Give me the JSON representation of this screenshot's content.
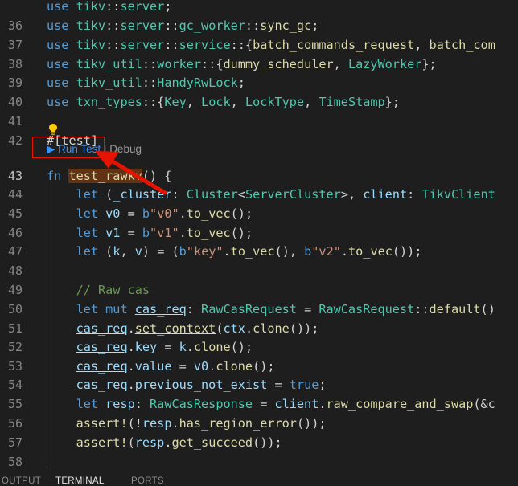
{
  "editor": {
    "lines": [
      {
        "n": "",
        "tokens": [
          [
            "kw",
            "use "
          ],
          [
            "ns",
            "tikv"
          ],
          [
            "p",
            "::"
          ],
          [
            "ns",
            "server"
          ],
          [
            "p",
            ";"
          ]
        ]
      },
      {
        "n": "36",
        "tokens": [
          [
            "kw",
            "use "
          ],
          [
            "ns",
            "tikv"
          ],
          [
            "p",
            "::"
          ],
          [
            "ns",
            "server"
          ],
          [
            "p",
            "::"
          ],
          [
            "ns",
            "gc_worker"
          ],
          [
            "p",
            "::"
          ],
          [
            "fn",
            "sync_gc"
          ],
          [
            "p",
            ";"
          ]
        ]
      },
      {
        "n": "37",
        "tokens": [
          [
            "kw",
            "use "
          ],
          [
            "ns",
            "tikv"
          ],
          [
            "p",
            "::"
          ],
          [
            "ns",
            "server"
          ],
          [
            "p",
            "::"
          ],
          [
            "ns",
            "service"
          ],
          [
            "p",
            "::{"
          ],
          [
            "fn",
            "batch_commands_request"
          ],
          [
            "p",
            ", "
          ],
          [
            "fn",
            "batch_com"
          ]
        ]
      },
      {
        "n": "38",
        "tokens": [
          [
            "kw",
            "use "
          ],
          [
            "ns",
            "tikv_util"
          ],
          [
            "p",
            "::"
          ],
          [
            "ns",
            "worker"
          ],
          [
            "p",
            "::{"
          ],
          [
            "fn",
            "dummy_scheduler"
          ],
          [
            "p",
            ", "
          ],
          [
            "ty",
            "LazyWorker"
          ],
          [
            "p",
            "};"
          ]
        ]
      },
      {
        "n": "39",
        "tokens": [
          [
            "kw",
            "use "
          ],
          [
            "ns",
            "tikv_util"
          ],
          [
            "p",
            "::"
          ],
          [
            "ty",
            "HandyRwLock"
          ],
          [
            "p",
            ";"
          ]
        ]
      },
      {
        "n": "40",
        "tokens": [
          [
            "kw",
            "use "
          ],
          [
            "ns",
            "txn_types"
          ],
          [
            "p",
            "::{"
          ],
          [
            "ty",
            "Key"
          ],
          [
            "p",
            ", "
          ],
          [
            "ty",
            "Lock"
          ],
          [
            "p",
            ", "
          ],
          [
            "ty",
            "LockType"
          ],
          [
            "p",
            ", "
          ],
          [
            "ty",
            "TimeStamp"
          ],
          [
            "p",
            "};"
          ]
        ]
      },
      {
        "n": "41",
        "tokens": []
      },
      {
        "n": "42",
        "tokens": [
          [
            "p",
            "#["
          ],
          [
            "p",
            "test"
          ],
          [
            "p",
            "]"
          ]
        ]
      },
      {
        "n": "43",
        "active": true,
        "tokens": [
          [
            "kw",
            "fn "
          ],
          [
            "fnhl",
            "test_rawkv"
          ],
          [
            "p",
            "() {"
          ]
        ]
      },
      {
        "n": "44",
        "tokens": [
          [
            "p",
            "    "
          ],
          [
            "kw",
            "let "
          ],
          [
            "p",
            "("
          ],
          [
            "var",
            "_cluster"
          ],
          [
            "p",
            ": "
          ],
          [
            "ty",
            "Cluster"
          ],
          [
            "p",
            "<"
          ],
          [
            "ty",
            "ServerCluster"
          ],
          [
            "p",
            ">, "
          ],
          [
            "var",
            "client"
          ],
          [
            "p",
            ": "
          ],
          [
            "ty",
            "TikvClient"
          ]
        ]
      },
      {
        "n": "45",
        "tokens": [
          [
            "p",
            "    "
          ],
          [
            "kw",
            "let "
          ],
          [
            "var",
            "v0"
          ],
          [
            "p",
            " = "
          ],
          [
            "kw",
            "b"
          ],
          [
            "str",
            "\"v0\""
          ],
          [
            "p",
            "."
          ],
          [
            "fn",
            "to_vec"
          ],
          [
            "p",
            "();"
          ]
        ]
      },
      {
        "n": "46",
        "tokens": [
          [
            "p",
            "    "
          ],
          [
            "kw",
            "let "
          ],
          [
            "var",
            "v1"
          ],
          [
            "p",
            " = "
          ],
          [
            "kw",
            "b"
          ],
          [
            "str",
            "\"v1\""
          ],
          [
            "p",
            "."
          ],
          [
            "fn",
            "to_vec"
          ],
          [
            "p",
            "();"
          ]
        ]
      },
      {
        "n": "47",
        "tokens": [
          [
            "p",
            "    "
          ],
          [
            "kw",
            "let "
          ],
          [
            "p",
            "("
          ],
          [
            "var",
            "k"
          ],
          [
            "p",
            ", "
          ],
          [
            "var",
            "v"
          ],
          [
            "p",
            ") = ("
          ],
          [
            "kw",
            "b"
          ],
          [
            "str",
            "\"key\""
          ],
          [
            "p",
            "."
          ],
          [
            "fn",
            "to_vec"
          ],
          [
            "p",
            "(), "
          ],
          [
            "kw",
            "b"
          ],
          [
            "str",
            "\"v2\""
          ],
          [
            "p",
            "."
          ],
          [
            "fn",
            "to_vec"
          ],
          [
            "p",
            "());"
          ]
        ]
      },
      {
        "n": "48",
        "tokens": []
      },
      {
        "n": "49",
        "tokens": [
          [
            "p",
            "    "
          ],
          [
            "cm",
            "// Raw cas"
          ]
        ]
      },
      {
        "n": "50",
        "tokens": [
          [
            "p",
            "    "
          ],
          [
            "kw",
            "let mut "
          ],
          [
            "varul",
            "cas_req"
          ],
          [
            "p",
            ": "
          ],
          [
            "ty",
            "RawCasRequest"
          ],
          [
            "p",
            " = "
          ],
          [
            "ty",
            "RawCasRequest"
          ],
          [
            "p",
            "::"
          ],
          [
            "fn",
            "default"
          ],
          [
            "p",
            "()"
          ]
        ]
      },
      {
        "n": "51",
        "tokens": [
          [
            "p",
            "    "
          ],
          [
            "varul",
            "cas_req"
          ],
          [
            "p",
            "."
          ],
          [
            "fnul",
            "set_context"
          ],
          [
            "p",
            "("
          ],
          [
            "var",
            "ctx"
          ],
          [
            "p",
            "."
          ],
          [
            "fn",
            "clone"
          ],
          [
            "p",
            "());"
          ]
        ]
      },
      {
        "n": "52",
        "tokens": [
          [
            "p",
            "    "
          ],
          [
            "varul",
            "cas_req"
          ],
          [
            "p",
            "."
          ],
          [
            "var",
            "key"
          ],
          [
            "p",
            " = "
          ],
          [
            "var",
            "k"
          ],
          [
            "p",
            "."
          ],
          [
            "fn",
            "clone"
          ],
          [
            "p",
            "();"
          ]
        ]
      },
      {
        "n": "53",
        "tokens": [
          [
            "p",
            "    "
          ],
          [
            "varul",
            "cas_req"
          ],
          [
            "p",
            "."
          ],
          [
            "var",
            "value"
          ],
          [
            "p",
            " = "
          ],
          [
            "var",
            "v0"
          ],
          [
            "p",
            "."
          ],
          [
            "fn",
            "clone"
          ],
          [
            "p",
            "();"
          ]
        ]
      },
      {
        "n": "54",
        "tokens": [
          [
            "p",
            "    "
          ],
          [
            "varul",
            "cas_req"
          ],
          [
            "p",
            "."
          ],
          [
            "var",
            "previous_not_exist"
          ],
          [
            "p",
            " = "
          ],
          [
            "kw",
            "true"
          ],
          [
            "p",
            ";"
          ]
        ]
      },
      {
        "n": "55",
        "tokens": [
          [
            "p",
            "    "
          ],
          [
            "kw",
            "let "
          ],
          [
            "var",
            "resp"
          ],
          [
            "p",
            ": "
          ],
          [
            "ty",
            "RawCasResponse"
          ],
          [
            "p",
            " = "
          ],
          [
            "var",
            "client"
          ],
          [
            "p",
            "."
          ],
          [
            "fn",
            "raw_compare_and_swap"
          ],
          [
            "p",
            "(&c"
          ]
        ]
      },
      {
        "n": "56",
        "tokens": [
          [
            "p",
            "    "
          ],
          [
            "fn",
            "assert!"
          ],
          [
            "p",
            "(!"
          ],
          [
            "var",
            "resp"
          ],
          [
            "p",
            "."
          ],
          [
            "fn",
            "has_region_error"
          ],
          [
            "p",
            "());"
          ]
        ]
      },
      {
        "n": "57",
        "tokens": [
          [
            "p",
            "    "
          ],
          [
            "fn",
            "assert!"
          ],
          [
            "p",
            "("
          ],
          [
            "var",
            "resp"
          ],
          [
            "p",
            "."
          ],
          [
            "fn",
            "get_succeed"
          ],
          [
            "p",
            "());"
          ]
        ]
      },
      {
        "n": "58",
        "tokens": []
      }
    ]
  },
  "codelens": {
    "run": "▶ Run Test",
    "sep": " | ",
    "debug": "Debug"
  },
  "panel": {
    "tabs": [
      "OUTPUT",
      "TERMINAL",
      "PORTS"
    ],
    "active": "TERMINAL"
  },
  "colors": {
    "annotation": "#e51400",
    "codelens_run": "#3794ff",
    "highlight": "#613214"
  },
  "icons": {
    "lightbulb": "lightbulb-icon",
    "arrow": "red-arrow-annotation"
  }
}
